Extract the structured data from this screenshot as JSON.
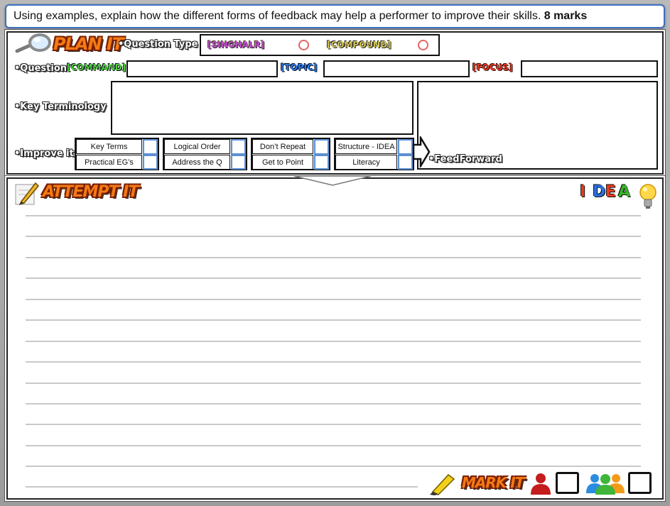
{
  "question": {
    "text": "Using examples, explain how the different forms of feedback may help a performer to improve their skills.",
    "marks": "8 marks"
  },
  "plan": {
    "title": "PLAN IT",
    "question_type_label": "•Question Type",
    "types": [
      "[SINGHALR]",
      "[COMPOUND]"
    ],
    "question_label": "•Question",
    "command_tag": "[COMMAND]",
    "topic_tag": "[TOPIC]",
    "focus_tag": "[FOCUS]",
    "key_terminology_label": "•Key Terminology",
    "improve_label": "•Improve it",
    "feedforward_label": "•FeedForward",
    "improve_items": [
      [
        "Key Terms",
        "Practical EG’s"
      ],
      [
        "Logical Order",
        "Address the Q"
      ],
      [
        "Don’t Repeat",
        "Get to Point"
      ],
      [
        "Structure - IDEA",
        "Literacy"
      ]
    ]
  },
  "attempt": {
    "title": "ATTEMPT IT",
    "idea_letters": [
      "I",
      "D",
      "E",
      "A"
    ],
    "idea_colors": [
      "#e53b1f",
      "#2b6fe0",
      "#e83b20",
      "#38b52c"
    ]
  },
  "mark": {
    "title": "MARK IT"
  },
  "colors": {
    "accent_blue": "#3c6fc0",
    "fire_orange": "#f47a14"
  },
  "icons": [
    "magnifier-icon",
    "pencil-icon",
    "lightbulb-icon",
    "highlighter-icon",
    "person-icon",
    "group-icon",
    "arrow-right-icon",
    "arrow-down-icon"
  ]
}
